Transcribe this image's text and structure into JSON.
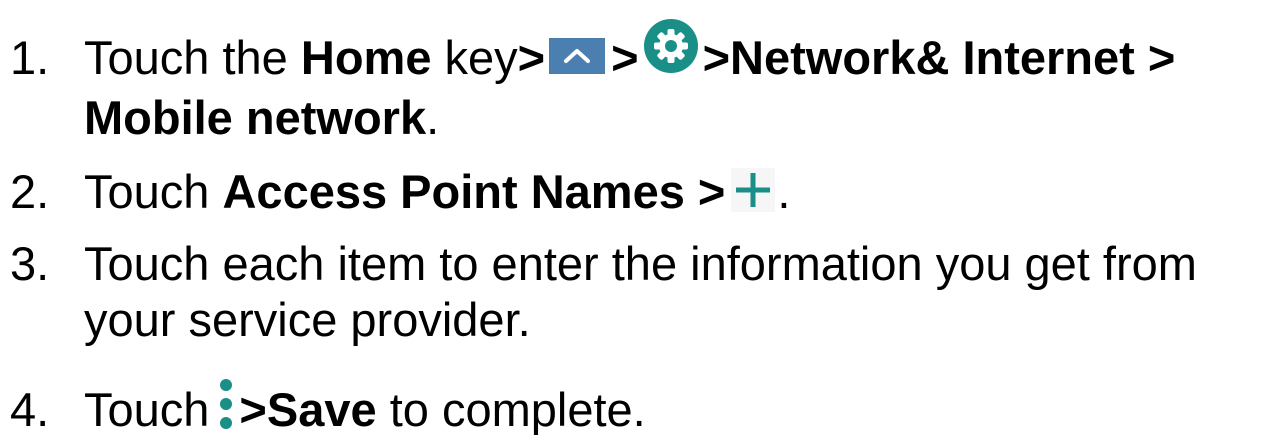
{
  "steps": [
    {
      "num": "1.",
      "pre": "Touch the ",
      "home_key": "Home",
      "after_home": " key",
      "sep1": ">",
      "sep2": ">",
      "bold_rest": ">Network& Internet >",
      "line2_bold": "Mobile network",
      "line2_end": "."
    },
    {
      "num": "2.",
      "pre": "Touch ",
      "bold": "Access Point Names >",
      "end": "."
    },
    {
      "num": "3.",
      "line1": "Touch each item to enter the information you get from",
      "line2": "your service provider."
    },
    {
      "num": "4.",
      "pre": "Touch",
      "bold": ">Save",
      "end": " to complete."
    }
  ],
  "icons": {
    "up": "chevron-up-icon",
    "settings": "gear-icon",
    "add": "plus-icon",
    "menu": "more-vert-icon"
  },
  "colors": {
    "teal": "#1a8f87",
    "up_bg": "#4b7fb0"
  }
}
